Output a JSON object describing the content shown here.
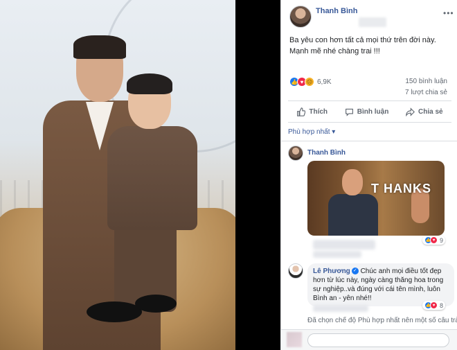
{
  "post": {
    "author": "Thanh Bình",
    "text_line1": "Ba yêu con hơn tất cả mọi thứ trên đời này.",
    "text_line2": "Mạnh mẽ nhé chàng trai !!!",
    "reaction_count": "6,9K",
    "comments_count": "150 bình luận",
    "shares_count": "7 lượt chia sẻ",
    "reaction_icons": [
      "like",
      "love",
      "sad"
    ]
  },
  "actions": {
    "like_label": "Thích",
    "comment_label": "Bình luận",
    "share_label": "Chia sẻ"
  },
  "comments": {
    "sort_label": "Phù hợp nhất",
    "items": [
      {
        "author": "Thanh Bình",
        "gif_text": "T HANKS",
        "reaction_count": "9"
      },
      {
        "author": "Lê Phương",
        "verified": true,
        "text_lines": [
          "Chúc anh mọi điều tốt đẹp",
          "hơn từ lúc này, ngày càng thăng hoa trong",
          "sự nghiệp..và đúng với cái tên mình, luôn",
          "Bình an - yên nhé!!"
        ],
        "reaction_count": "8"
      }
    ],
    "notice": "Đã chọn chế độ Phù hợp nhất nên một số câu trả"
  },
  "colors": {
    "link_blue": "#385898",
    "like_blue": "#1877f2",
    "love_red": "#f02849",
    "sad_yellow": "#f7b125",
    "meta_gray": "#606770"
  }
}
